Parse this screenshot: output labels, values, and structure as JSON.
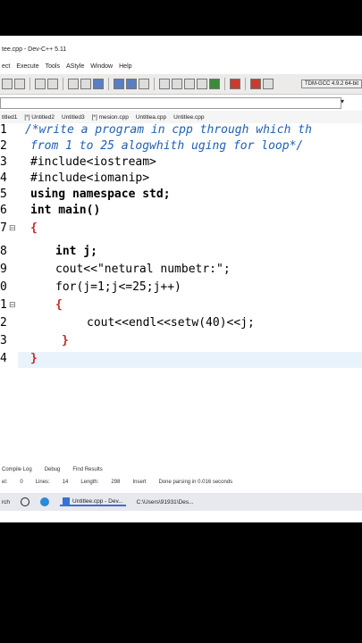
{
  "window": {
    "title": "tee.cpp - Dev-C++ 5.11"
  },
  "menu": [
    "ect",
    "Execute",
    "Tools",
    "AStyle",
    "Window",
    "Help"
  ],
  "compiler": "TDM-GCC 4.9.2 64-bit",
  "tabs": [
    "titled1",
    "[*] Untitled2",
    "Untitled3",
    "[*] mesion.cpp",
    "Untitlea.cpp",
    "Untitlee.cpp"
  ],
  "editor": {
    "lines": [
      {
        "n": "1",
        "text": "/*write a program in cpp through which th"
      },
      {
        "n": "2",
        "text": "from 1 to 25 alogwhith uging for loop*/"
      },
      {
        "n": "3",
        "text": "#include<iostream>"
      },
      {
        "n": "4",
        "text": "#include<iomanip>"
      },
      {
        "n": "5",
        "text": "using namespace std;"
      },
      {
        "n": "6",
        "text": "int main()"
      },
      {
        "n": "7",
        "text": "{"
      },
      {
        "n": "8",
        "text": "int j;"
      },
      {
        "n": "9",
        "text": "cout<<\"netural numbetr:\";"
      },
      {
        "n": "0",
        "text": "for(j=1;j<=25;j++)"
      },
      {
        "n": "1",
        "text": "{"
      },
      {
        "n": "2",
        "text": "cout<<endl<<setw(40)<<j;"
      },
      {
        "n": "3",
        "text": "}"
      },
      {
        "n": "4",
        "text": "}"
      }
    ]
  },
  "bottom_tabs": [
    "Compile Log",
    "Debug",
    "Find Results"
  ],
  "status": {
    "col_label": "el:",
    "col_value": "0",
    "lines_label": "Lines:",
    "lines_value": "14",
    "length_label": "Length:",
    "length_value": "298",
    "mode": "Insert",
    "parse": "Done parsing in 0.016 seconds"
  },
  "taskbar": {
    "search": "rch",
    "app": "Untitlee.cpp - Dev...",
    "path": "C:\\Users\\91931\\Des..."
  }
}
